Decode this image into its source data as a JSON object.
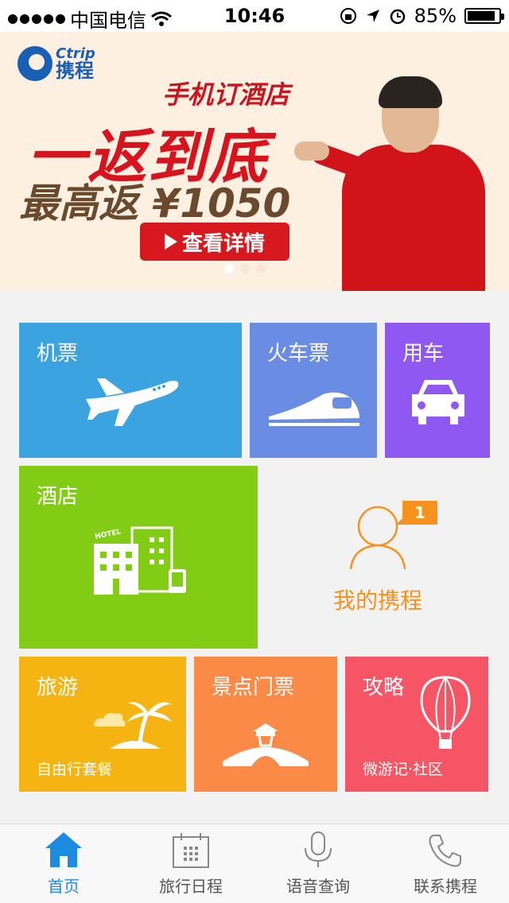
{
  "status_bar": {
    "carrier": "中国电信",
    "time": "10:46",
    "battery": "85%"
  },
  "banner": {
    "logo_en": "Ctrip",
    "logo_cn": "携程",
    "line1": "手机订酒店",
    "line2": "一返到底",
    "line3": "最高返 ¥1050",
    "button": "查看详情",
    "page_count": 3,
    "active_page": 1
  },
  "tiles": {
    "flight": {
      "label": "机票",
      "color": "#3ba3e0"
    },
    "train": {
      "label": "火车票",
      "color": "#6b8ce3"
    },
    "car": {
      "label": "用车",
      "color": "#8f58f0"
    },
    "hotel": {
      "label": "酒店",
      "icon_text": "HOTEL",
      "color": "#83cc15"
    },
    "my_ctrip": {
      "label": "我的携程",
      "badge": "1",
      "color": "#f7921e"
    },
    "travel": {
      "label": "旅游",
      "sub": "自由行套餐",
      "color": "#f5b411"
    },
    "ticket": {
      "label": "景点门票",
      "color": "#fc8a47"
    },
    "guide": {
      "label": "攻略",
      "sub": "微游记·社区",
      "color": "#f55565"
    }
  },
  "tabbar": {
    "items": [
      {
        "label": "首页",
        "icon": "home-icon",
        "active": true
      },
      {
        "label": "旅行日程",
        "icon": "calendar-icon",
        "active": false
      },
      {
        "label": "语音查询",
        "icon": "microphone-icon",
        "active": false
      },
      {
        "label": "联系携程",
        "icon": "phone-icon",
        "active": false
      }
    ],
    "active_color": "#1c8be0"
  }
}
